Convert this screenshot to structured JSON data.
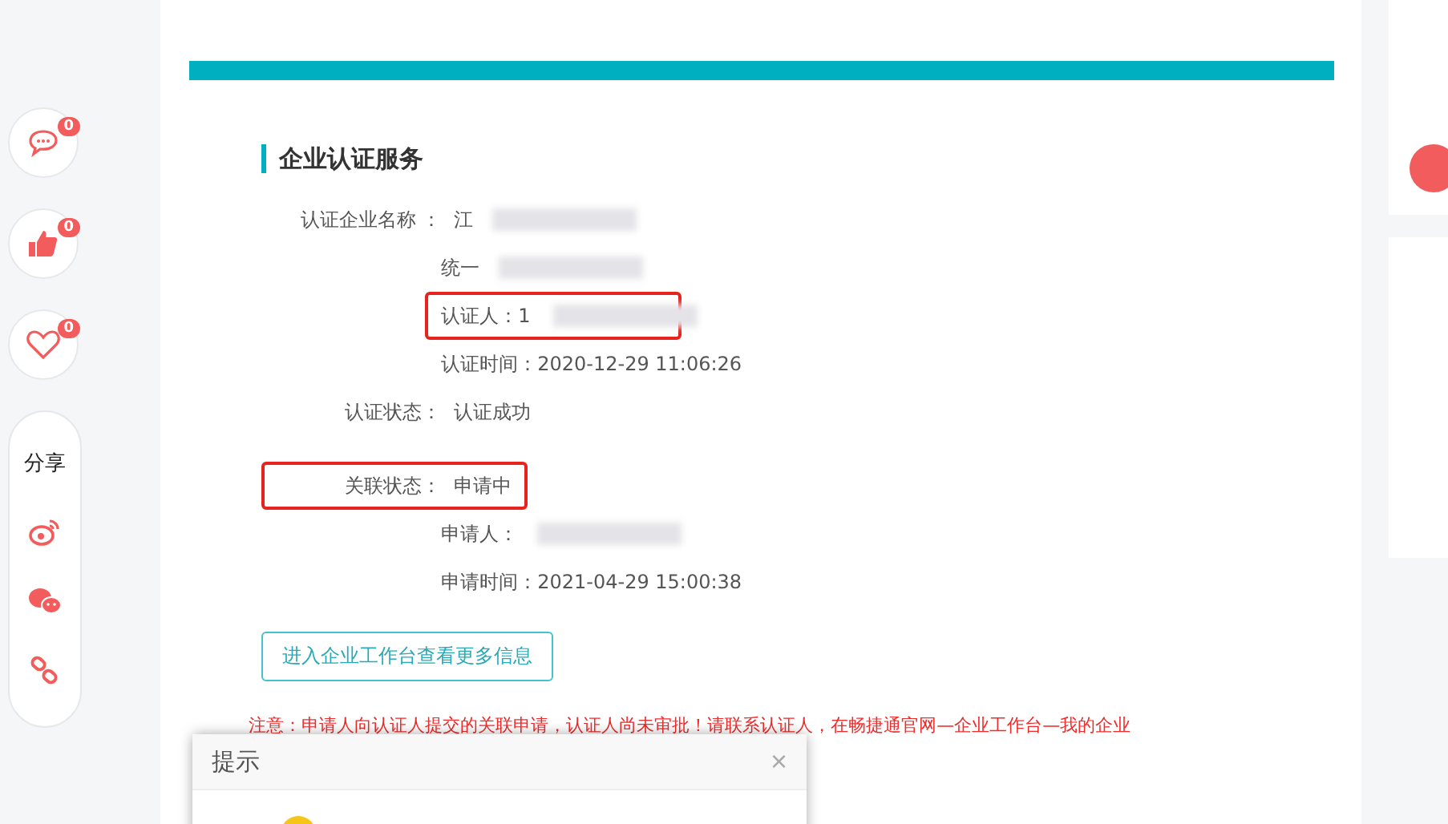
{
  "sidebar": {
    "actions": [
      {
        "kind": "comment",
        "count": "0"
      },
      {
        "kind": "like",
        "count": "0"
      },
      {
        "kind": "favorite",
        "count": "0"
      }
    ],
    "share": {
      "label": "分享",
      "items": [
        {
          "kind": "weibo"
        },
        {
          "kind": "wechat"
        },
        {
          "kind": "link"
        }
      ]
    }
  },
  "section": {
    "title": "企业认证服务",
    "groups": [
      {
        "rows": [
          {
            "label": "认证企业名称 ：",
            "value": "江",
            "redacted": true,
            "highlighted": false
          },
          {
            "value": "统一",
            "redacted": true,
            "highlighted": false
          },
          {
            "value": "认证人：1",
            "redacted": true,
            "highlighted": true
          },
          {
            "value": "认证时间：2020-12-29 11:06:26",
            "redacted": false,
            "highlighted": false
          },
          {
            "label": "认证状态：",
            "value": "认证成功",
            "redacted": false,
            "highlighted": false
          }
        ]
      },
      {
        "rows": [
          {
            "label": "关联状态：",
            "value": "申请中",
            "redacted": false,
            "highlighted": true
          },
          {
            "value": "申请人：",
            "redacted": true,
            "highlighted": false
          },
          {
            "value": "申请时间：2021-04-29 15:00:38",
            "redacted": false,
            "highlighted": false
          }
        ]
      }
    ],
    "button": "进入企业工作台查看更多信息",
    "notice": "注意：申请人向认证人提交的关联申请，认证人尚未审批！请联系认证人，在畅捷通官网—企业工作台—我的企业"
  },
  "dialog": {
    "title": "提示",
    "close": "×"
  }
}
